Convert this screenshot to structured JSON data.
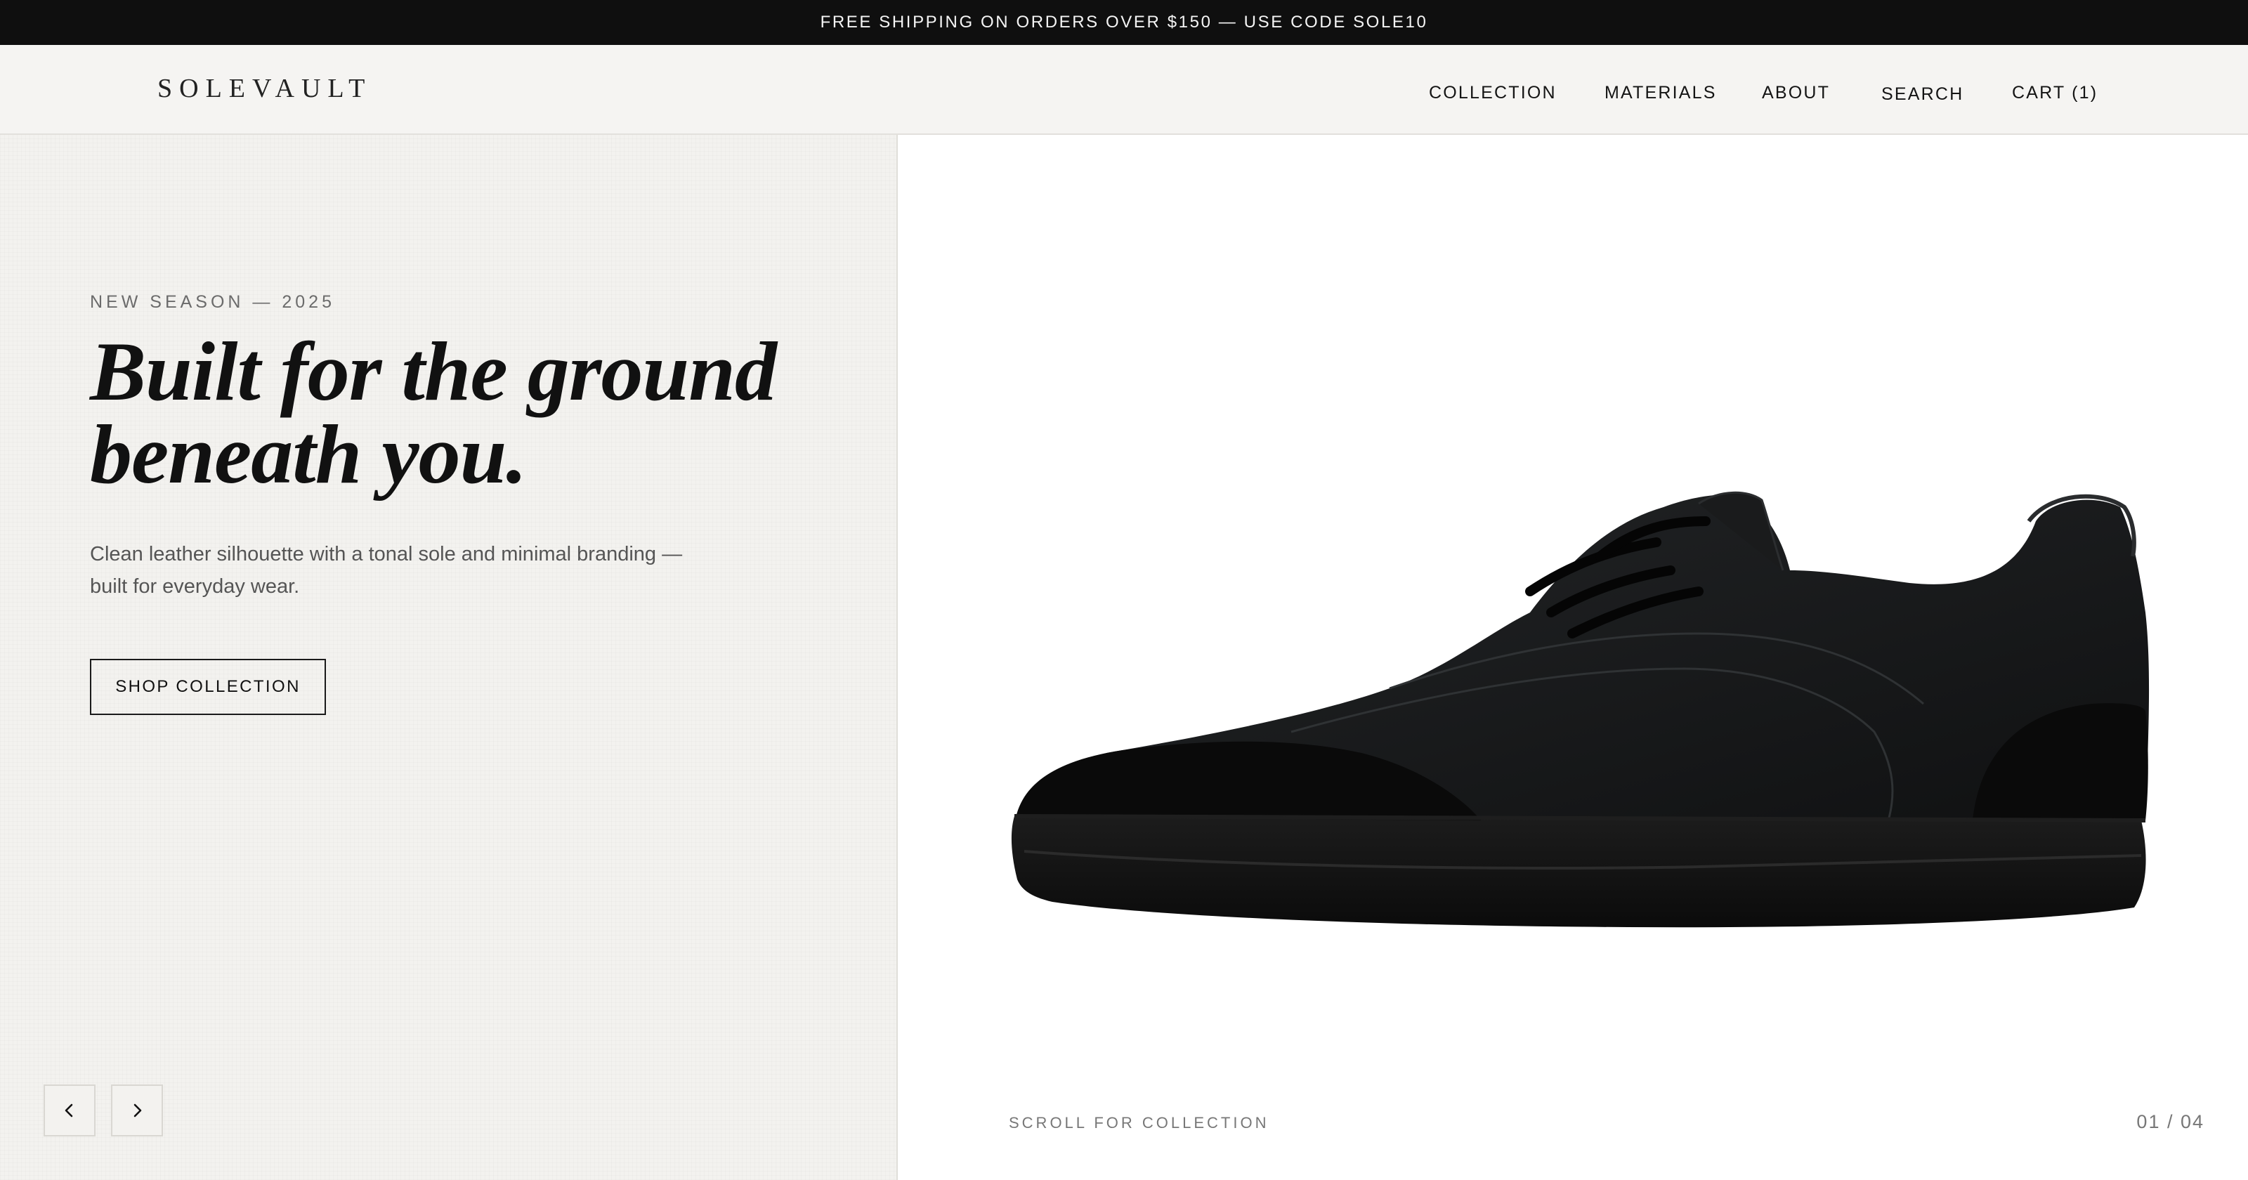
{
  "announcement": {
    "text": "FREE SHIPPING ON ORDERS OVER $150 — USE CODE SOLE10"
  },
  "header": {
    "logo": "SOLEVAULT",
    "nav": {
      "collection": "COLLECTION",
      "materials": "MATERIALS",
      "about": "ABOUT",
      "search": "SEARCH",
      "cart": "CART (1)"
    }
  },
  "hero": {
    "eyebrow": "NEW SEASON — 2025",
    "headline_line1": "Built for the ground",
    "headline_line2": "beneath you.",
    "subcopy_line1": "Clean leather silhouette with a tonal sole and minimal branding —",
    "subcopy_line2": "built for everyday wear.",
    "cta_label": "SHOP COLLECTION"
  },
  "carousel": {
    "prev_icon": "chevron-left-icon",
    "next_icon": "chevron-right-icon",
    "scroll_hint": "SCROLL FOR COLLECTION",
    "counter": "01 / 04"
  },
  "colors": {
    "announce_bg": "#0f0f0f",
    "header_bg": "#f5f4f2",
    "left_panel_bg": "#f3f2ef",
    "text_primary": "#111111",
    "text_muted": "#6b6b6b"
  }
}
